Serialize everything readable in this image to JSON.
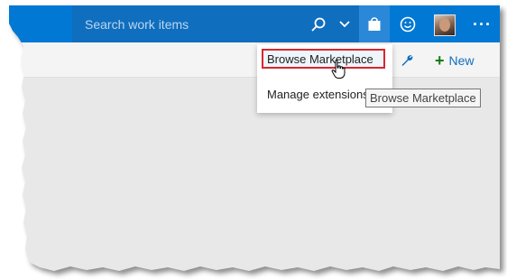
{
  "header": {
    "search_placeholder": "Search work items"
  },
  "icons": {
    "search": "search-icon",
    "chevron": "chevron-down-icon",
    "marketplace": "shopping-bag-icon",
    "feedback": "smiley-icon",
    "avatar": "user-avatar",
    "more": "more-ellipsis-icon",
    "settings": "wrench-icon",
    "cursor": "hand-cursor-icon"
  },
  "toolbar": {
    "new_label": "New"
  },
  "marketplace_menu": {
    "items": [
      {
        "label": "Browse Marketplace",
        "highlighted": true
      },
      {
        "label": "Manage extensions"
      }
    ]
  },
  "tooltip": {
    "text": "Browse Marketplace"
  },
  "colors": {
    "accent": "#0078d4",
    "highlight_border": "#d9262e",
    "new_plus": "#107c10"
  }
}
